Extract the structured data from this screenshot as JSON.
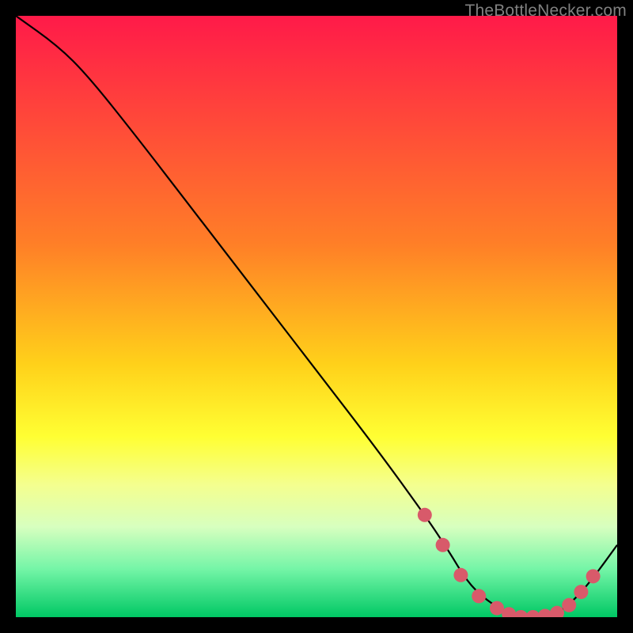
{
  "watermark": "TheBottleNecker.com",
  "chart_data": {
    "type": "line",
    "title": "",
    "xlabel": "",
    "ylabel": "",
    "xlim": [
      0,
      100
    ],
    "ylim": [
      0,
      100
    ],
    "gradient_stops": [
      {
        "offset": 0,
        "color": "#ff1a49"
      },
      {
        "offset": 38,
        "color": "#ff7f27"
      },
      {
        "offset": 58,
        "color": "#ffd11a"
      },
      {
        "offset": 70,
        "color": "#ffff33"
      },
      {
        "offset": 78,
        "color": "#f4ff8f"
      },
      {
        "offset": 85,
        "color": "#d7ffbf"
      },
      {
        "offset": 92,
        "color": "#74f5a7"
      },
      {
        "offset": 100,
        "color": "#00c864"
      }
    ],
    "series": [
      {
        "name": "bottleneck-curve",
        "x": [
          0,
          7,
          12,
          20,
          30,
          40,
          50,
          60,
          68,
          72,
          75,
          78,
          82,
          86,
          90,
          93,
          96,
          100
        ],
        "y": [
          100,
          95,
          90,
          80,
          67,
          54,
          41,
          28,
          17,
          11,
          6,
          3,
          0.5,
          0,
          0.5,
          3,
          6.5,
          12
        ]
      }
    ],
    "markers": {
      "name": "highlight-dots",
      "color": "#d85a6a",
      "size": 9,
      "x": [
        68,
        71,
        74,
        77,
        80,
        82,
        84,
        86,
        88,
        90,
        92,
        94,
        96
      ],
      "y": [
        17,
        12,
        7,
        3.5,
        1.5,
        0.5,
        0,
        0,
        0.2,
        0.7,
        2,
        4.2,
        6.8
      ]
    }
  }
}
